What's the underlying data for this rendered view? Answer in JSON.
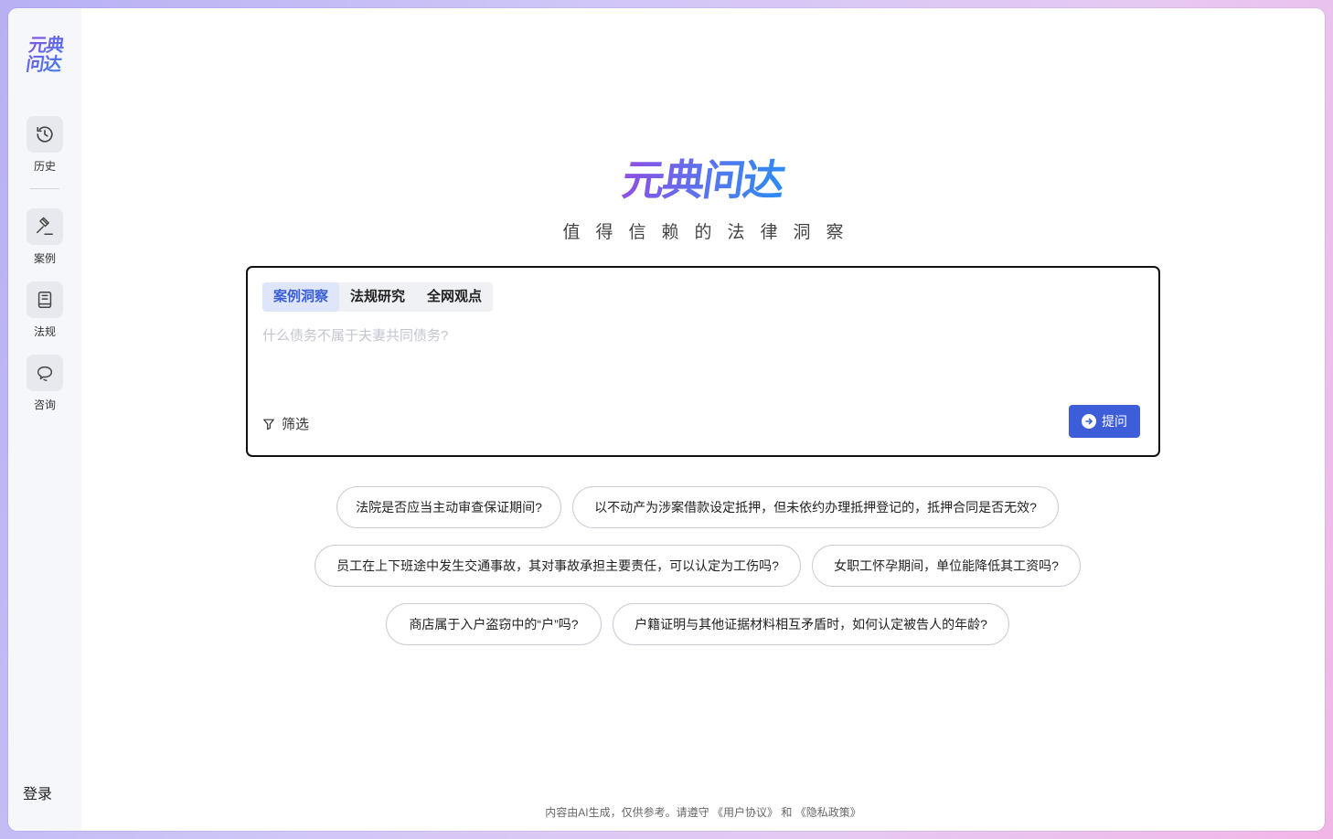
{
  "brand": {
    "logo_line1": "元典",
    "logo_line2": "问达",
    "title": "元典问达",
    "slogan": "值得信赖的法律洞察"
  },
  "sidebar": {
    "items": [
      {
        "label": "历史",
        "icon": "history-icon"
      },
      {
        "label": "案例",
        "icon": "gavel-icon"
      },
      {
        "label": "法规",
        "icon": "book-icon"
      },
      {
        "label": "咨询",
        "icon": "chat-bubble-icon"
      }
    ],
    "login": "登录"
  },
  "search": {
    "tabs": [
      {
        "label": "案例洞察",
        "active": true
      },
      {
        "label": "法规研究",
        "active": false
      },
      {
        "label": "全网观点",
        "active": false
      }
    ],
    "placeholder": "什么债务不属于夫妻共同债务?",
    "value": "",
    "filter_label": "筛选",
    "ask_label": "提问"
  },
  "suggestions": [
    "法院是否应当主动审查保证期间?",
    "以不动产为涉案借款设定抵押，但未依约办理抵押登记的，抵押合同是否无效?",
    "员工在上下班途中发生交通事故，其对事故承担主要责任，可以认定为工伤吗?",
    "女职工怀孕期间，单位能降低其工资吗?",
    "商店属于入户盗窃中的“户”吗?",
    "户籍证明与其他证据材料相互矛盾时，如何认定被告人的年龄?"
  ],
  "footer": {
    "text_prefix": "内容由AI生成，仅供参考。请遵守",
    "user_agreement": "《用户协议》",
    "conjunction": "和",
    "privacy_policy": "《隐私政策》"
  },
  "colors": {
    "accent": "#3d5ed8",
    "tab_active_bg": "#dfe6fb",
    "sidebar_bg": "#f6f7fb"
  }
}
